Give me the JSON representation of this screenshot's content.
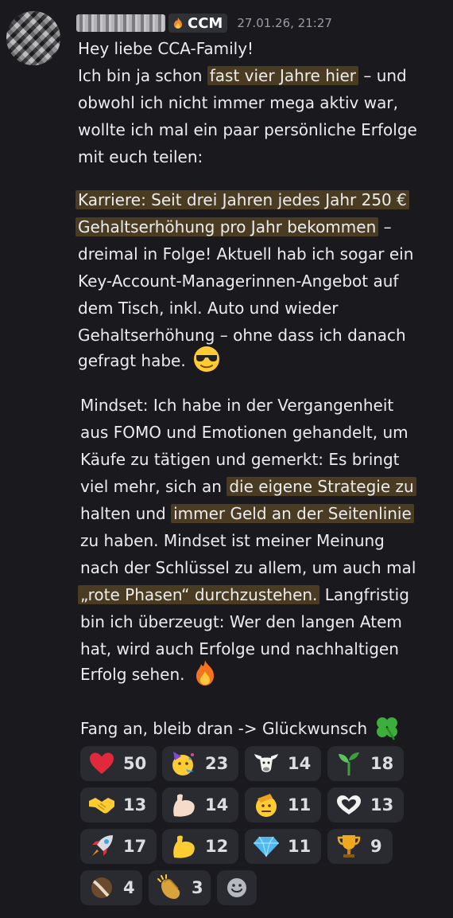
{
  "message": {
    "tag": "CCM",
    "timestamp": "27.01.26, 21:27",
    "p1": {
      "l1": "Hey liebe CCA-Family!",
      "l2a": "Ich bin ja schon ",
      "l2b": "fast vier Jahre hier",
      "l2c": " – und",
      "l3": "obwohl ich nicht immer mega aktiv war,",
      "l4": "wollte ich mal ein paar persönliche Erfolge",
      "l5": "mit euch teilen:"
    },
    "p2": {
      "l1": "Karriere: Seit drei Jahren jedes Jahr 250 €",
      "l2a": "Gehaltserhöhung pro Jahr bekommen",
      "l2b": " –",
      "l3": "dreimal in Folge! Aktuell hab ich sogar ein",
      "l4": "Key-Account-Managerinnen-Angebot auf",
      "l5": "dem Tisch, inkl. Auto und wieder",
      "l6": "Gehaltserhöhung – ohne dass ich danach",
      "l7": "gefragt habe."
    },
    "p3": {
      "l1": "Mindset: Ich habe in der Vergangenheit",
      "l2": "aus FOMO und Emotionen gehandelt, um",
      "l3": "Käufe zu tätigen und gemerkt: Es bringt",
      "l4a": "viel mehr, sich an ",
      "l4b": "die eigene Strategie zu",
      "l5a": "halten und ",
      "l5b": "immer Geld an der Seitenlinie",
      "l6": "zu haben. Mindset ist meiner Meinung",
      "l7": "nach der Schlüssel zu allem, um auch mal",
      "l8a": "„rote Phasen“ durchzustehen.",
      "l8b": " Langfristig",
      "l9": "bin ich überzeugt: Wer den langen Atem",
      "l10": "hat, wird auch Erfolge und nachhaltigen",
      "l11": "Erfolg sehen."
    },
    "p4": "Fang an, bleib dran -> Glückwunsch"
  },
  "reactions": [
    {
      "icon": "heart-icon",
      "count": "50"
    },
    {
      "icon": "party-face-icon",
      "count": "23"
    },
    {
      "icon": "bull-icon",
      "count": "14"
    },
    {
      "icon": "seedling-icon",
      "count": "18"
    },
    {
      "icon": "handshake-icon",
      "count": "13"
    },
    {
      "icon": "flexed-biceps-light-icon",
      "count": "14"
    },
    {
      "icon": "saluting-face-icon",
      "count": "11"
    },
    {
      "icon": "heart-hands-icon",
      "count": "13"
    },
    {
      "icon": "rocket-icon",
      "count": "17"
    },
    {
      "icon": "flexed-biceps-icon",
      "count": "12"
    },
    {
      "icon": "gem-icon",
      "count": "11"
    },
    {
      "icon": "trophy-icon",
      "count": "9"
    },
    {
      "icon": "coconut-icon",
      "count": "4"
    },
    {
      "icon": "clapping-hands-icon",
      "count": "3"
    },
    {
      "icon": "add-reaction-icon",
      "count": ""
    }
  ],
  "colors": {
    "background": "#1a1a1e",
    "highlight": "#4a3c22",
    "reaction_bg": "#2a2b30",
    "timestamp": "#9a9ca3"
  }
}
